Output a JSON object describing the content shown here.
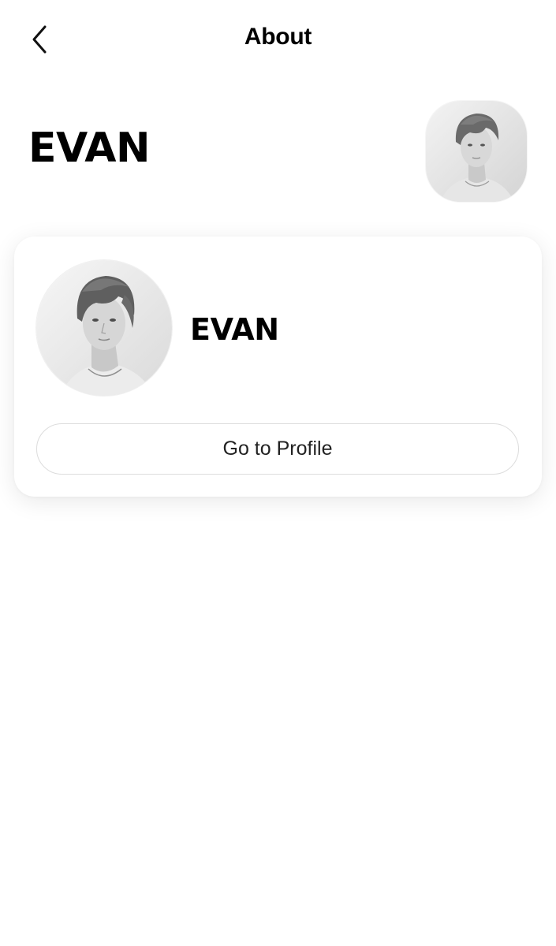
{
  "nav": {
    "title": "About",
    "back_icon": "chevron-left-icon"
  },
  "header": {
    "name": "EVAN"
  },
  "card": {
    "name": "EVAN",
    "button_label": "Go to Profile"
  },
  "colors": {
    "background": "#ffffff",
    "text": "#000000",
    "button_border": "#dcdcdc"
  }
}
